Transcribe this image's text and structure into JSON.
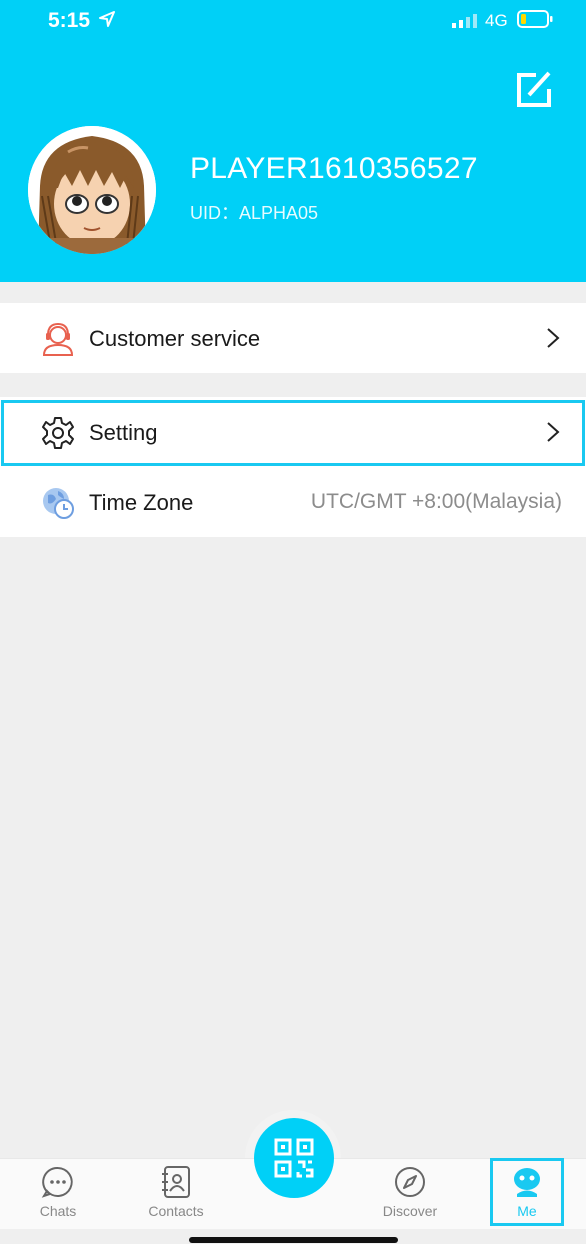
{
  "status_bar": {
    "time": "5:15",
    "network": "4G"
  },
  "profile": {
    "username": "PLAYER1610356527",
    "uid": "UID：ALPHA05"
  },
  "menu": {
    "customer_service": "Customer service",
    "setting": "Setting",
    "time_zone": "Time Zone",
    "time_zone_value": "UTC/GMT +8:00(Malaysia)"
  },
  "tabs": {
    "chats": "Chats",
    "contacts": "Contacts",
    "discover": "Discover",
    "me": "Me"
  },
  "colors": {
    "accent": "#00d0f7",
    "highlight": "#19c9f1",
    "service_icon": "#e8614f"
  }
}
